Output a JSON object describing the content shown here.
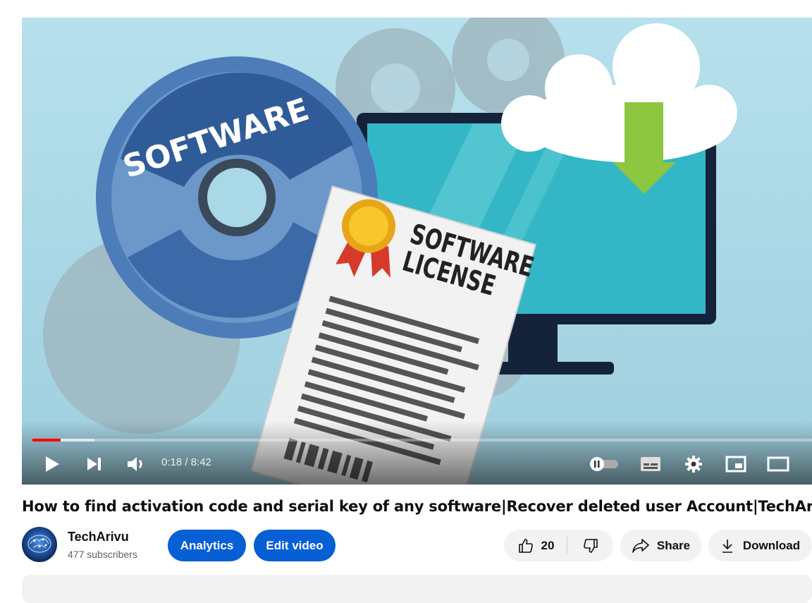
{
  "player": {
    "thumbnail_text": {
      "disc": "SOFTWARE",
      "license_line1": "SOFTWARE",
      "license_line2": "LICENSE"
    },
    "time_display": "0:18 / 8:42",
    "progress": {
      "played_fraction": 0.036,
      "buffered_fraction": 0.08
    },
    "icons": [
      "play-icon",
      "next-icon",
      "volume-icon",
      "autoplay-toggle-icon",
      "subtitles-icon",
      "settings-gear-icon",
      "miniplayer-icon",
      "theater-mode-icon"
    ]
  },
  "video": {
    "title": "How to find activation code and serial key of any software|Recover deleted user Account|TechArivu"
  },
  "channel": {
    "name": "TechArivu",
    "subscribers": "477 subscribers"
  },
  "actions": {
    "analytics_label": "Analytics",
    "edit_label": "Edit video",
    "like_count": "20",
    "share_label": "Share",
    "download_label": "Download"
  },
  "colors": {
    "brand_blue": "#065fd4",
    "progress_red": "#ff0000",
    "pill_grey": "#f2f2f2"
  }
}
